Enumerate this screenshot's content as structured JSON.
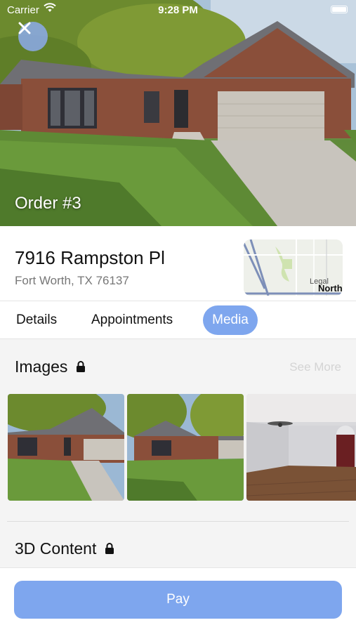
{
  "status_bar": {
    "carrier": "Carrier",
    "time": "9:28 PM"
  },
  "header": {
    "order_title": "Order #3"
  },
  "address": {
    "street": "7916 Rampston Pl",
    "city": "Fort Worth, TX 76137",
    "map_legal": "Legal",
    "map_label": "North"
  },
  "tabs": [
    {
      "label": "Details",
      "active": false
    },
    {
      "label": "Appointments",
      "active": false
    },
    {
      "label": "Media",
      "active": true
    }
  ],
  "images_section": {
    "title": "Images",
    "see_more": "See More"
  },
  "content_section": {
    "title": "3D Content"
  },
  "pay_button": {
    "label": "Pay"
  },
  "colors": {
    "accent": "#7ea6ee",
    "muted_text": "#777777",
    "disabled_text": "#d4d4d4"
  }
}
